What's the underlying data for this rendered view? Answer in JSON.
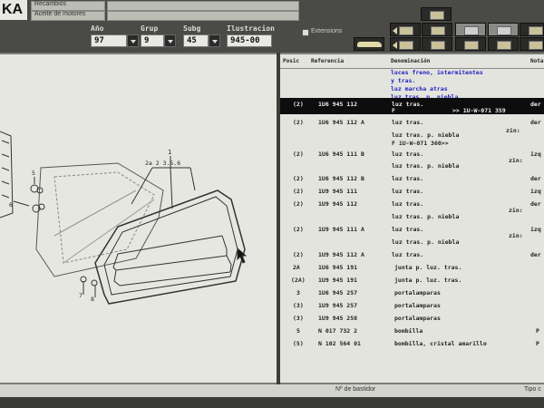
{
  "app": {
    "logo": "KA",
    "top_labels": [
      "Recambios",
      "Aceite de motores"
    ],
    "extensions_label": "Extensions"
  },
  "fields": {
    "anio": {
      "label": "Año",
      "value": "97"
    },
    "grup": {
      "label": "Grup",
      "value": "9"
    },
    "subg": {
      "label": "Subg",
      "value": "45"
    },
    "ilustracion": {
      "label": "Ilustracion",
      "value": "945-00"
    }
  },
  "table": {
    "headers": {
      "pos": "Posic",
      "ref": "Referencia",
      "den": "Denominación",
      "nota": "Nota"
    },
    "title_lines": [
      "luces freno, intermitentes",
      "y tras.",
      "luz marcha atras",
      "luz tras. p. niebla"
    ],
    "rows": [
      {
        "pos": "(2)",
        "ref": "1U6 945 112",
        "den": "luz tras.",
        "extra": "der",
        "sub": "F",
        "sub2": ">> 1U-W-071 359",
        "selected": true
      },
      {
        "pos": "(2)",
        "ref": "1U6 945 112 A",
        "den": "luz tras.",
        "extra": "der",
        "sub": "zin:"
      },
      {
        "pos": "",
        "ref": "",
        "den": "luz tras. p. niebla",
        "extra": ""
      },
      {
        "pos": "",
        "ref": "",
        "den": "F 1U-W-071 360>>",
        "extra": ""
      },
      {
        "pos": "(2)",
        "ref": "1U6 945 111 B",
        "den": "luz tras.",
        "extra": "izq",
        "sub": "zin:"
      },
      {
        "pos": "",
        "ref": "",
        "den": "luz tras. p. niebla",
        "extra": ""
      },
      {
        "pos": "(2)",
        "ref": "1U6 945 112 B",
        "den": "luz tras.",
        "extra": "der"
      },
      {
        "pos": "(2)",
        "ref": "1U9 945 111",
        "den": "luz tras.",
        "extra": "izq"
      },
      {
        "pos": "(2)",
        "ref": "1U9 945 112",
        "den": "luz tras.",
        "extra": "der",
        "sub": "zin:"
      },
      {
        "pos": "",
        "ref": "",
        "den": "luz tras. p. niebla",
        "extra": ""
      },
      {
        "pos": "(2)",
        "ref": "1U9 945 111 A",
        "den": "luz tras.",
        "extra": "izq",
        "sub": "zin:"
      },
      {
        "pos": "",
        "ref": "",
        "den": "luz tras. p. niebla",
        "extra": ""
      },
      {
        "pos": "(2)",
        "ref": "1U9 945 112 A",
        "den": "luz tras.",
        "extra": "der"
      },
      {
        "pos": "2A",
        "ref": "1U6 945 191",
        "den": "junta p. luz. tras.",
        "extra": ""
      },
      {
        "pos": "(2A)",
        "ref": "1U9 945 191",
        "den": "junta p. luz. tras.",
        "extra": ""
      },
      {
        "pos": "3",
        "ref": "1U6 945 257",
        "den": "portalamparas",
        "extra": ""
      },
      {
        "pos": "(3)",
        "ref": "1U9 945 257",
        "den": "portalamparas",
        "extra": ""
      },
      {
        "pos": "(3)",
        "ref": "1U9 945 258",
        "den": "portalamparas",
        "extra": ""
      },
      {
        "pos": "5",
        "ref": "N 017 732 2",
        "den": "bombilla",
        "extra": "P"
      },
      {
        "pos": "(5)",
        "ref": "N 102 564 01",
        "den": "bombilla, cristal amarillo",
        "extra": "P"
      }
    ]
  },
  "diagram": {
    "labels": [
      "1",
      "2a 2 3.5.6",
      "5",
      "6",
      "7",
      "8"
    ]
  },
  "status": {
    "bastidor": "Nº de bastidor",
    "tipo": "Tipo c"
  }
}
